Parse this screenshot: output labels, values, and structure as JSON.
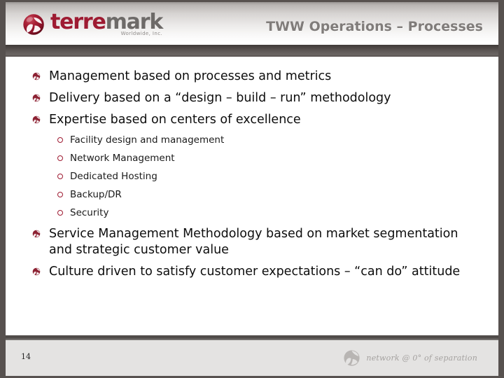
{
  "header": {
    "logo": {
      "icon": "terremark-globe-logo-icon",
      "word_primary": "terre",
      "word_secondary": "mark",
      "subtitle": "Worldwide, Inc."
    },
    "title": "TWW Operations – Processes"
  },
  "content": {
    "bullets": [
      {
        "text": "Management based on processes and metrics",
        "marker": "globe-bullet-icon",
        "children": []
      },
      {
        "text": "Delivery based on a “design – build – run” methodology",
        "marker": "globe-bullet-icon",
        "children": []
      },
      {
        "text": "Expertise based on centers of excellence",
        "marker": "globe-bullet-icon",
        "children": [
          {
            "text": "Facility design and management",
            "marker": "circle-bullet-icon"
          },
          {
            "text": "Network Management",
            "marker": "circle-bullet-icon"
          },
          {
            "text": "Dedicated Hosting",
            "marker": "circle-bullet-icon"
          },
          {
            "text": "Backup/DR",
            "marker": "circle-bullet-icon"
          },
          {
            "text": "Security",
            "marker": "circle-bullet-icon"
          }
        ]
      },
      {
        "text": "Service Management Methodology based on market segmentation and strategic customer value",
        "marker": "globe-bullet-icon",
        "children": []
      },
      {
        "text": "Culture driven to satisfy customer expectations – “can do” attitude",
        "marker": "globe-bullet-icon",
        "children": []
      }
    ]
  },
  "footer": {
    "page_number": "14",
    "tagline": "network @ 0° of separation",
    "mark_icon": "terremark-globe-mono-icon"
  },
  "colors": {
    "brand_red": "#9e1b32",
    "frame_gray": "#57514f",
    "title_gray": "#807c7a",
    "footer_gray": "#e4e3e2",
    "tagline_gray": "#a5a2a0"
  }
}
